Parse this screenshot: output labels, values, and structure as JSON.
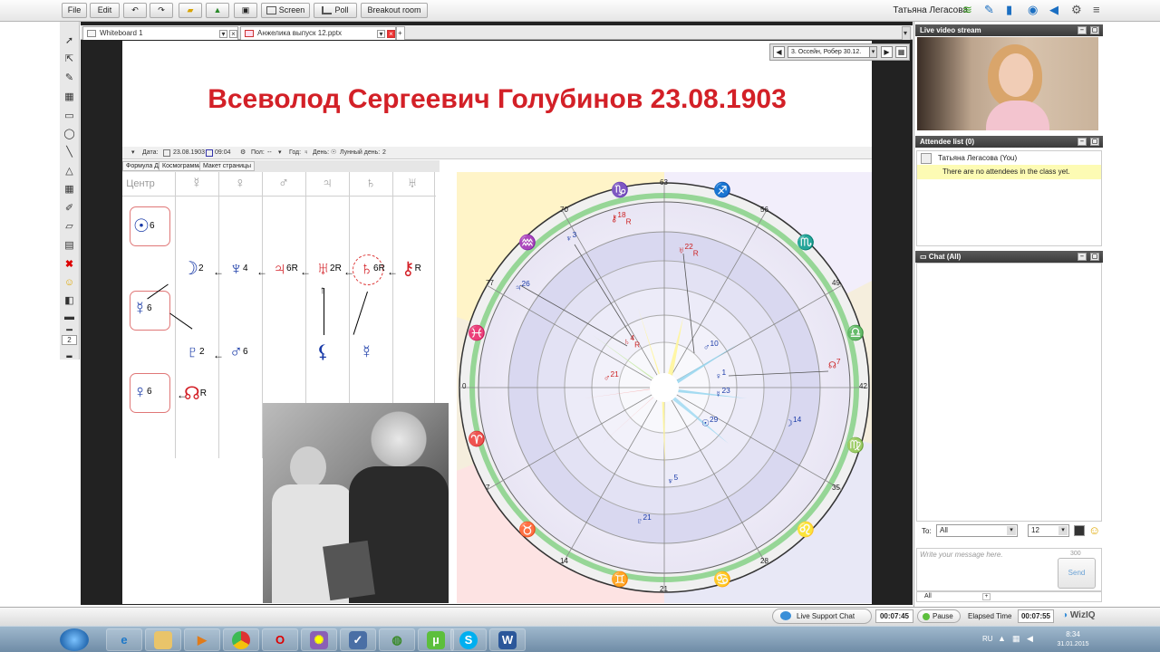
{
  "toolbar": {
    "file": "File",
    "edit": "Edit",
    "screen": "Screen",
    "poll": "Poll",
    "breakout": "Breakout room",
    "user": "Татьяна Легасова"
  },
  "tabs": [
    {
      "label": "Whiteboard 1"
    },
    {
      "label": "Анжелика выпуск 12.pptx"
    }
  ],
  "slide_nav": {
    "current": "3. Оссейн, Робер 30.12."
  },
  "slide": {
    "title": "Всеволод Сергеевич Голубинов 23.08.1903",
    "date_header": {
      "date_label": "Дата:",
      "date": "23.08.1903",
      "time": "09:04",
      "sex_label": "Пол:",
      "sex_value": "--",
      "year_label": "Год:",
      "day_label": "День:",
      "lunar_label": "Лунный день:",
      "lunar_value": "2"
    },
    "subtabs": [
      "Формула Души",
      "Космограмма",
      "Макет страницы"
    ],
    "grid_headers": [
      "Центр",
      "☿",
      "♀",
      "♂",
      "♃",
      "♄",
      "♅"
    ],
    "nodes": [
      {
        "glyph": "☉",
        "sup": "6"
      },
      {
        "glyph": "☽",
        "sup": "2"
      },
      {
        "glyph": "♆",
        "sup": "4"
      },
      {
        "glyph": "♃",
        "sup": "6",
        "sub": "R"
      },
      {
        "glyph": "♅",
        "sup": "2",
        "sub": "R"
      },
      {
        "glyph": "♄",
        "sup": "6",
        "sub": "R"
      },
      {
        "glyph": "⚷",
        "sup": "R"
      },
      {
        "glyph": "☿",
        "sup": "6"
      },
      {
        "glyph": "♇",
        "sup": "2"
      },
      {
        "glyph": "♂",
        "sup": "6"
      },
      {
        "glyph": "⚸",
        "sup": ""
      },
      {
        "glyph": "☿",
        "sup": ""
      },
      {
        "glyph": "♀",
        "sup": "6"
      },
      {
        "glyph": "☊",
        "sup": "R"
      }
    ],
    "wheel_degrees": [
      "63",
      "56",
      "49",
      "42",
      "35",
      "28",
      "21",
      "14",
      "7",
      "0",
      "77",
      "70"
    ],
    "wheel_planets": [
      {
        "glyph": "⚷",
        "n": "18",
        "r": "R"
      },
      {
        "glyph": "♅",
        "n": "22",
        "r": "R"
      },
      {
        "glyph": "♆",
        "n": "3"
      },
      {
        "glyph": "♃",
        "n": "26"
      },
      {
        "glyph": "♄",
        "n": "4",
        "r": "R"
      },
      {
        "glyph": "♂",
        "n": "21"
      },
      {
        "glyph": "♂",
        "n": "10"
      },
      {
        "glyph": "♀",
        "n": "1"
      },
      {
        "glyph": "☿",
        "n": "23"
      },
      {
        "glyph": "☉",
        "n": "29"
      },
      {
        "glyph": "☽",
        "n": "14"
      },
      {
        "glyph": "☊",
        "n": "7"
      },
      {
        "glyph": "♆",
        "n": "5"
      },
      {
        "glyph": "♇",
        "n": "21"
      }
    ]
  },
  "right_panel": {
    "video_title": "Live video stream",
    "attendee_title": "Attendee list (0)",
    "attendee_name": "Татьяна Легасова (You)",
    "attendee_note": "There are no attendees in the class yet.",
    "chat_title": "Chat (All)",
    "to_label": "To:",
    "to_value": "All",
    "font_size": "12",
    "message_placeholder": "Write your message here.",
    "char_count": "300",
    "send": "Send",
    "all_label": "All"
  },
  "bottom": {
    "support": "Live Support Chat",
    "timer": "00:07:45",
    "pause": "Pause",
    "elapsed_label": "Elapsed Time",
    "elapsed_value": "00:07:55",
    "logo": "WizIQ"
  },
  "taskbar": {
    "lang": "RU",
    "time": "8:34",
    "date": "31.01.2015"
  }
}
